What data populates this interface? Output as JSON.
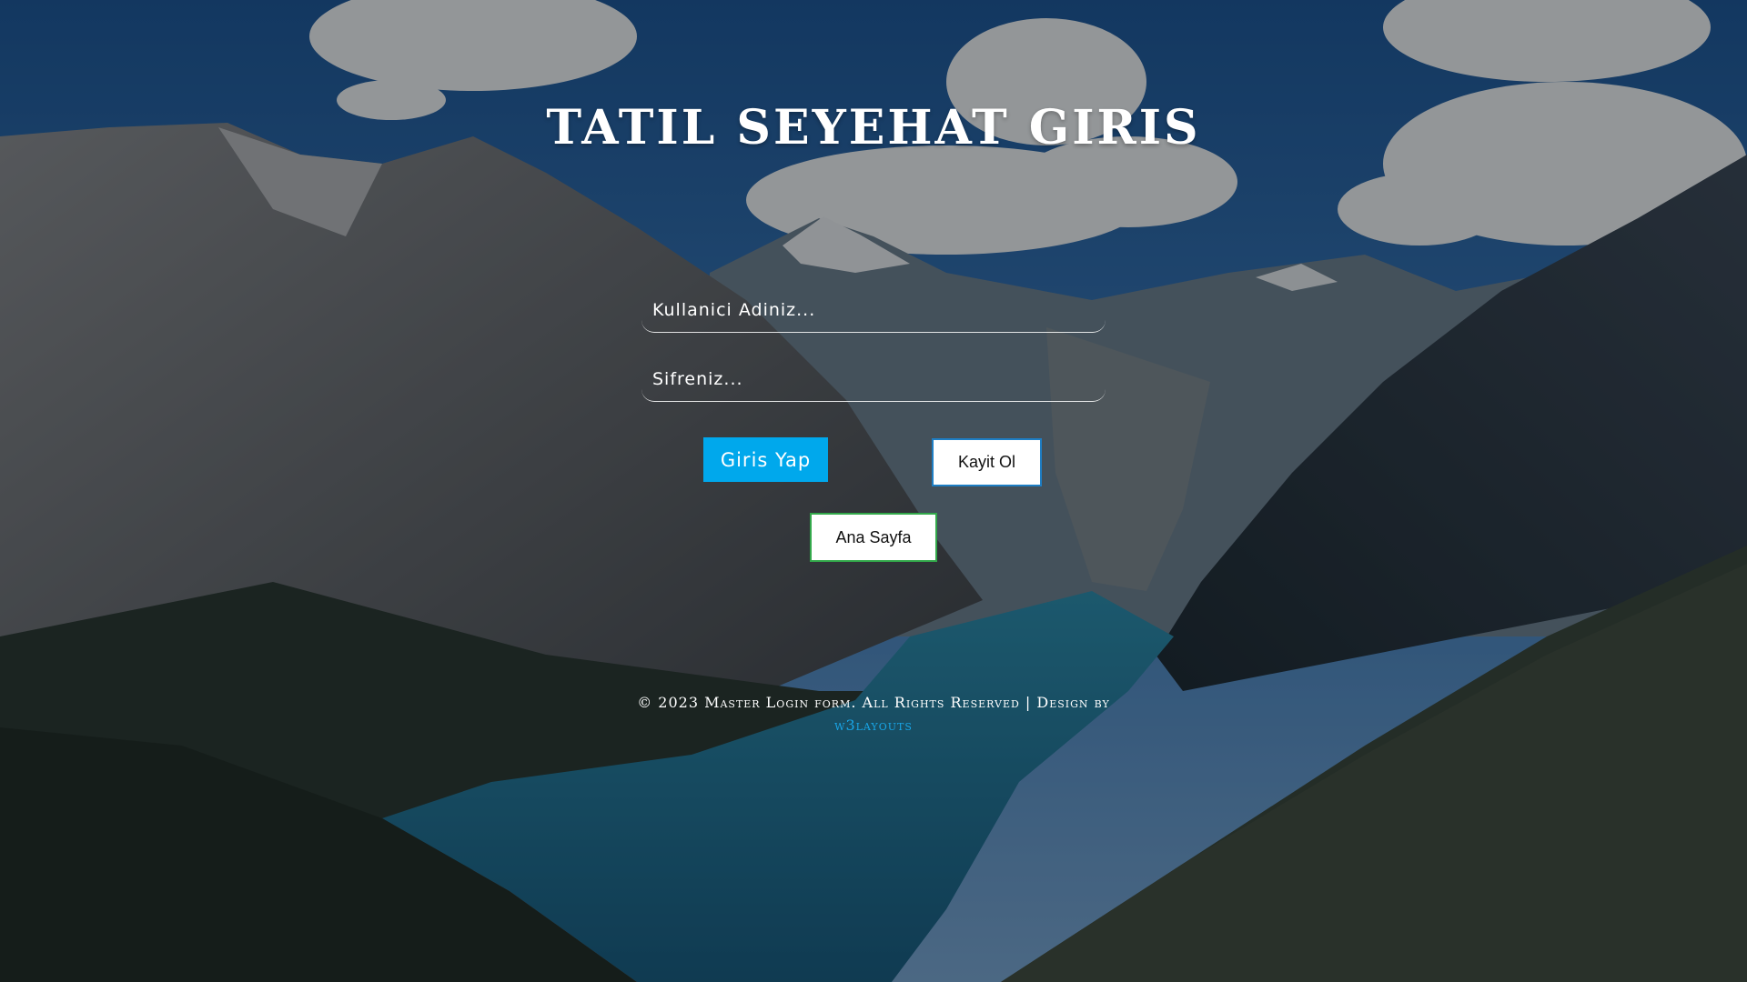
{
  "page": {
    "title": "TATIL SEYEHAT GIRIS"
  },
  "form": {
    "username_placeholder": "Kullanici Adiniz...",
    "username_value": "",
    "password_placeholder": "Sifreniz...",
    "password_value": "",
    "login_button": "Giris Yap",
    "register_button": "Kayit Ol",
    "home_button": "Ana Sayfa"
  },
  "footer": {
    "text": "© 2023 Master Login form. All Rights Reserved | Design by",
    "link_text": "w3layouts"
  },
  "colors": {
    "login_button_bg": "#00a8ec",
    "register_button_border": "#1e7ec4",
    "home_button_border": "#32a84a",
    "footer_link": "#18a6e8"
  },
  "background": {
    "scene": "mountain-valley-lake-photo"
  }
}
